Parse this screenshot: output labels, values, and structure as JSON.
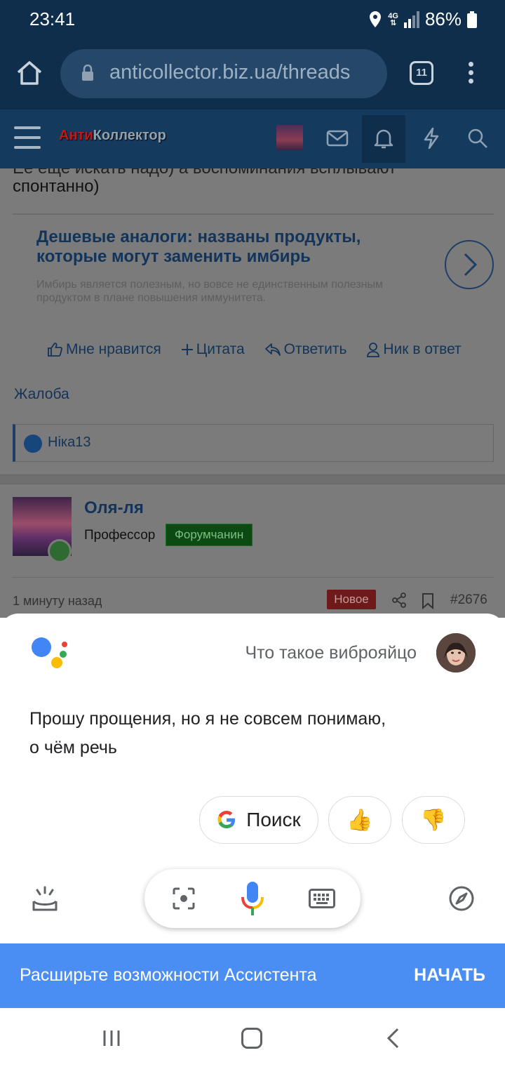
{
  "status_bar": {
    "time": "23:41",
    "network": "4G",
    "battery": "86%"
  },
  "browser": {
    "url": "anticollector.biz.ua/threads",
    "tab_count": "11"
  },
  "site": {
    "logo_part1": "Анти",
    "logo_part2": "Коллектор"
  },
  "post": {
    "text_cut": "Ее еще искать надо) а воспоминания всплывают",
    "text_end": "спонтанно)",
    "actions": {
      "like": "Мне нравится",
      "quote": "Цитата",
      "reply": "Ответить",
      "mention": "Ник в ответ"
    },
    "report": "Жалоба",
    "liked_by": "Ніка13"
  },
  "ad": {
    "title": "Дешевые аналоги: названы продукты, которые могут заменить имбирь",
    "description": "Имбирь является полезным, но вовсе не единственным полезным продуктом в плане повышения иммунитета."
  },
  "next_post": {
    "author": "Оля-ля",
    "rank": "Профессор",
    "badge": "Форумчанин",
    "time": "1 минуту назад",
    "new_label": "Новое",
    "number": "#2676"
  },
  "assistant": {
    "query": "Что такое виброяйцо",
    "answer": "Прошу прощения, но я не совсем понимаю, о чём речь",
    "search_chip": "Поиск",
    "thumbs_up": "👍",
    "thumbs_down": "👎"
  },
  "promo": {
    "text": "Расширьте возможности Ассистента",
    "cta": "НАЧАТЬ"
  },
  "colors": {
    "assistant_blue": "#4a8ef4",
    "forum_navy": "#143a5e"
  }
}
